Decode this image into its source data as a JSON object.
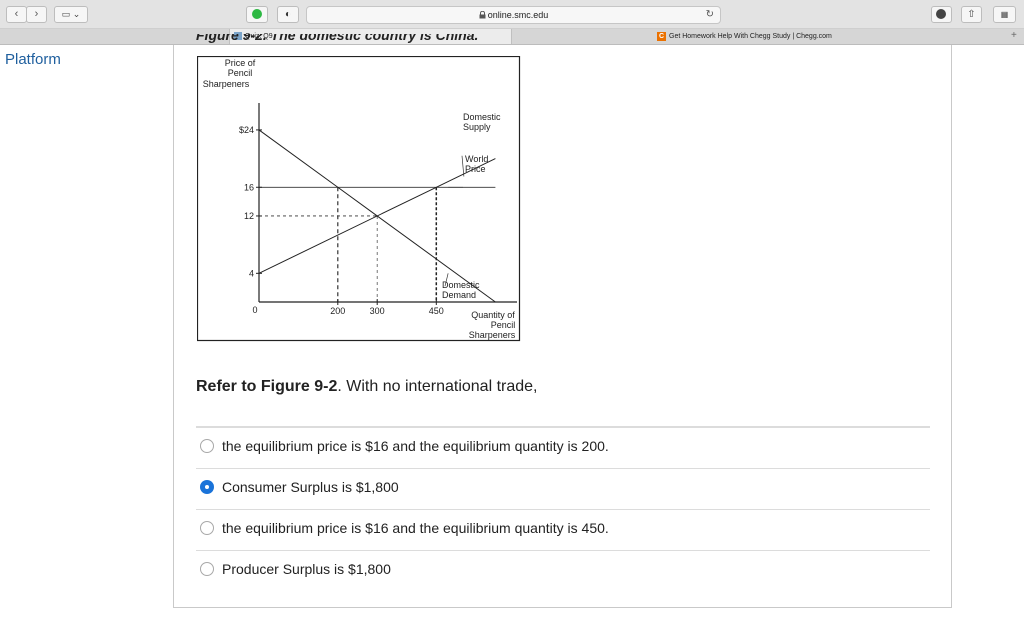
{
  "browser": {
    "url": "online.smc.edu",
    "lock_icon": "lock-icon",
    "back_icon": "‹",
    "forward_icon": "›",
    "reload_icon": "↻",
    "share_icon": "⇧",
    "tabs_icon": "▦",
    "sidebar_icon": "▭ ⌄",
    "shield_icon": "◐",
    "new_tab_icon": "+",
    "tabs": [
      {
        "title": "Quiz: Q9"
      },
      {
        "title": "Get Homework Help With Chegg Study | Chegg.com",
        "icon_letter": "C"
      }
    ]
  },
  "sidebar": {
    "platform_label": "Platform"
  },
  "figure": {
    "title": "Figure 9-2. The domestic country is China.",
    "y_axis_label": [
      "Price of",
      "Pencil",
      "Sharpeners"
    ],
    "x_axis_label": [
      "Quantity of",
      "Pencil",
      "Sharpeners"
    ],
    "origin_label": "0",
    "y_tick_labels": [
      "$24",
      "16",
      "12",
      "4"
    ],
    "x_tick_labels": [
      "200",
      "300",
      "450"
    ],
    "supply_label": [
      "Domestic",
      "Supply"
    ],
    "world_price_label": [
      "World",
      "Price"
    ],
    "demand_label": [
      "Domestic",
      "Demand"
    ]
  },
  "chart_data": {
    "type": "line",
    "title": "Figure 9-2. The domestic country is China.",
    "xlabel": "Quantity of Pencil Sharpeners",
    "ylabel": "Price of Pencil Sharpeners",
    "xlim": [
      0,
      600
    ],
    "ylim": [
      0,
      28
    ],
    "series": [
      {
        "name": "Domestic Supply",
        "x": [
          0,
          450,
          600
        ],
        "y": [
          4,
          16,
          20
        ]
      },
      {
        "name": "Domestic Demand",
        "x": [
          0,
          200,
          300,
          600
        ],
        "y": [
          24,
          16,
          12,
          0
        ]
      },
      {
        "name": "World Price",
        "x": [
          0,
          600
        ],
        "y": [
          16,
          16
        ]
      }
    ],
    "y_ticks": [
      24,
      16,
      12,
      4
    ],
    "x_ticks": [
      200,
      300,
      450
    ]
  },
  "question": {
    "prefix": "Refer to",
    "figure_ref": "Figure 9-2",
    "suffix": ". With no international trade,"
  },
  "answers": [
    {
      "text": "the equilibrium price is $16 and the equilibrium quantity is 200.",
      "selected": false
    },
    {
      "text": "Consumer Surplus is $1,800",
      "selected": true
    },
    {
      "text": "the equilibrium price is $16 and the equilibrium quantity is 450.",
      "selected": false
    },
    {
      "text": "Producer Surplus is $1,800",
      "selected": false
    }
  ],
  "colors": {
    "accent": "#1a73d9",
    "link": "#1f5f9e",
    "chegg": "#eb7100"
  }
}
